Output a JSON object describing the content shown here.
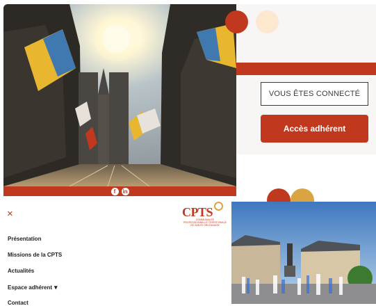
{
  "hero": {
    "social": [
      {
        "label": "f",
        "icon": "facebook-icon"
      },
      {
        "label": "in",
        "icon": "linkedin-icon"
      }
    ]
  },
  "account": {
    "status_label": "VOUS ÊTES CONNECTÉ",
    "member_button": "Accès adhérent"
  },
  "menu": {
    "close_symbol": "×",
    "logo": {
      "main": "CPTS",
      "subtitle": "COMMUNAUTÉ PROFESSIONNELLE TERRITORIALE DE SANTÉ ORLÉANAISE"
    },
    "items": [
      {
        "label": "Présentation"
      },
      {
        "label": "Missions de la CPTS"
      },
      {
        "label": "Actualités"
      },
      {
        "label": "Espace adhérent",
        "chevron": "▾"
      },
      {
        "label": "Contact"
      }
    ]
  },
  "colors": {
    "brand_red": "#c0391f",
    "accent_gold": "#d9a441",
    "cream": "#fbe8cf"
  }
}
